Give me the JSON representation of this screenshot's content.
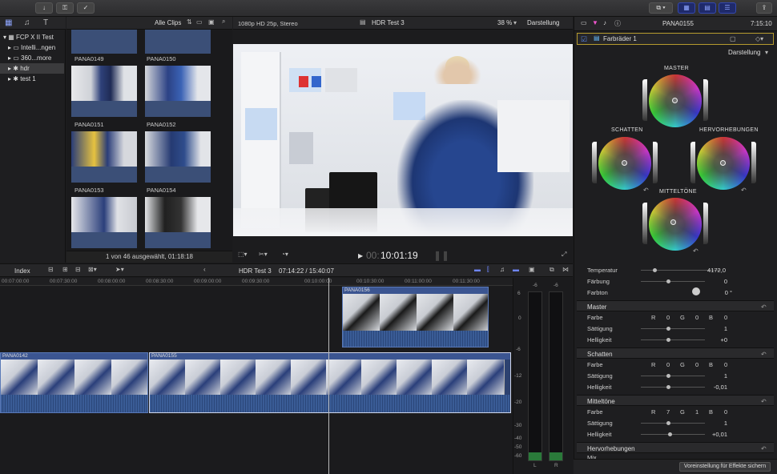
{
  "toolbar": {
    "clip_filter": "Alle Clips",
    "time_display": "7:15:10"
  },
  "library": {
    "items": [
      {
        "label": "FCP X II Test",
        "level": 0
      },
      {
        "label": "Intelli...ngen",
        "level": 1
      },
      {
        "label": "360...more",
        "level": 1
      },
      {
        "label": "hdr",
        "level": 1,
        "selected": true
      },
      {
        "label": "test 1",
        "level": 1
      }
    ]
  },
  "browser": {
    "thumbs": [
      "PANA0149",
      "PANA0150",
      "PANA0151",
      "PANA0152",
      "PANA0153",
      "PANA0154"
    ],
    "status": "1 von 46 ausgewählt, 01:18:18"
  },
  "viewer": {
    "format": "1080p HD 25p, Stereo",
    "project": "HDR Test 3",
    "zoom": "38 %",
    "view_menu": "Darstellung",
    "timecode_prefix": "00:",
    "timecode": "10:01:19"
  },
  "inspector": {
    "clip_name": "PANA0155",
    "effect": "Farbräder 1",
    "view_menu": "Darstellung",
    "wheels": {
      "master": "MASTER",
      "shadows": "SCHATTEN",
      "highlights": "HERVORHEBUNGEN",
      "midtones": "MITTELTÖNE"
    },
    "temperature": {
      "label": "Temperatur",
      "value": "4172,0"
    },
    "tint": {
      "label": "Färbung",
      "value": "0"
    },
    "hue": {
      "label": "Farbton",
      "value": "0 °"
    },
    "sections": [
      {
        "title": "Master",
        "farbe": "Farbe",
        "r": "R",
        "rv": "0",
        "g": "G",
        "gv": "0",
        "b": "B",
        "bv": "0",
        "sat_label": "Sättigung",
        "sat": "1",
        "bright_label": "Helligkeit",
        "bright": "+0"
      },
      {
        "title": "Schatten",
        "farbe": "Farbe",
        "r": "R",
        "rv": "0",
        "g": "G",
        "gv": "0",
        "b": "B",
        "bv": "0",
        "sat_label": "Sättigung",
        "sat": "1",
        "bright_label": "Helligkeit",
        "bright": "-0,01"
      },
      {
        "title": "Mitteltöne",
        "farbe": "Farbe",
        "r": "R",
        "rv": "7",
        "g": "G",
        "gv": "1",
        "b": "B",
        "bv": "0",
        "sat_label": "Sättigung",
        "sat": "1",
        "bright_label": "Helligkeit",
        "bright": "+0,01"
      }
    ],
    "last_section": "Hervorhebungen",
    "mix_label": "Mix",
    "save_button": "Voreinstellung für Effekte sichern"
  },
  "timeline": {
    "index": "Index",
    "project": "HDR Test 3",
    "duration": "07:14:22 / 15:40:07",
    "ruler": [
      "00:07:00:00",
      "00:07:30:00",
      "00:08:00:00",
      "00:08:30:00",
      "00:09:00:00",
      "00:09:30:00",
      "00:10:00:00",
      "00:10:30:00",
      "00:11:00:00",
      "00:11:30:00"
    ],
    "clips": {
      "upper": "PANA0156",
      "main1": "PANA0142",
      "main2": "PANA0155"
    },
    "meter_scale": [
      "6",
      "0",
      "-6",
      "-12",
      "-20",
      "-30",
      "-40",
      "-50",
      "-60"
    ],
    "meter_peaks": [
      "-6",
      "-6"
    ],
    "meter_channels": [
      "L",
      "R"
    ]
  }
}
